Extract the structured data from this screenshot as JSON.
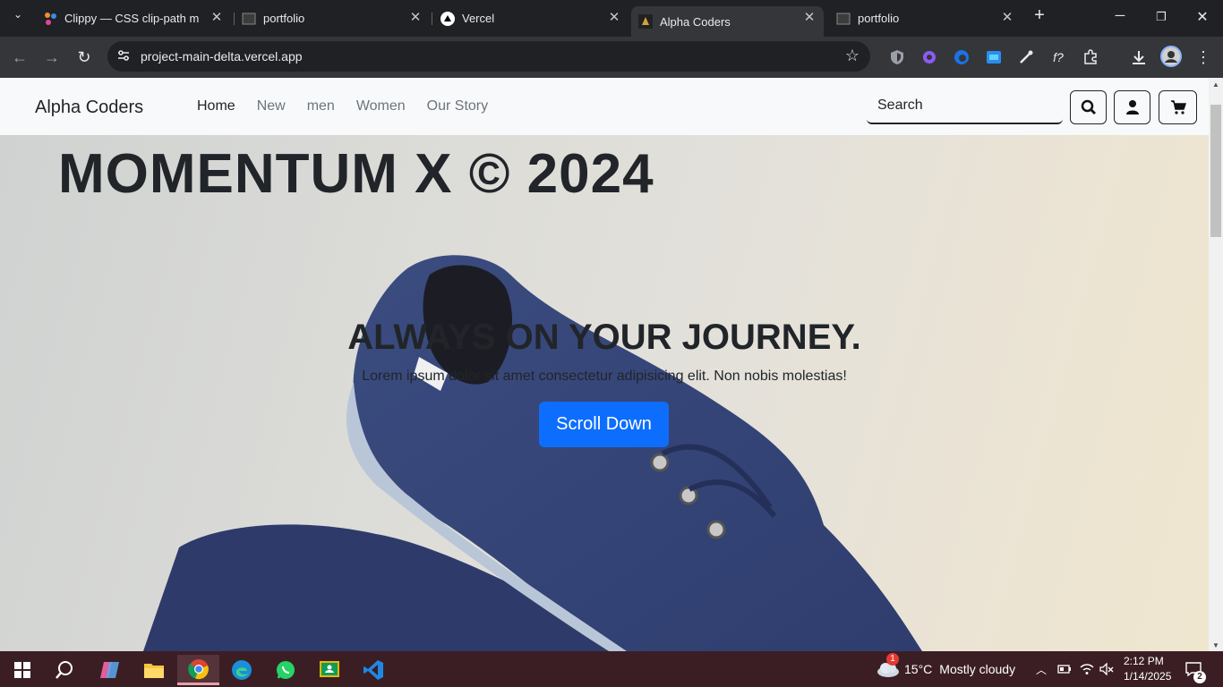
{
  "browser": {
    "tabs": [
      {
        "title": "Clippy — CSS clip-path maker",
        "favicon": "clippy-icon",
        "active": false
      },
      {
        "title": "portfolio",
        "favicon": "portfolio-icon",
        "active": false
      },
      {
        "title": "Vercel",
        "favicon": "vercel-icon",
        "active": false
      },
      {
        "title": "Alpha Coders",
        "favicon": "alpha-coders-icon",
        "active": true
      },
      {
        "title": "portfolio",
        "favicon": "portfolio-icon",
        "active": false
      }
    ],
    "url": "project-main-delta.vercel.app",
    "accent": "#35363a"
  },
  "site": {
    "brand": "Alpha Coders",
    "nav": [
      "Home",
      "New",
      "men",
      "Women",
      "Our Story"
    ],
    "search_placeholder": "Search",
    "hero_title": "MOMENTUM X © 2024",
    "headline": "ALWAYS ON YOUR JOURNEY.",
    "lead": "Lorem ipsum dolor sit amet consectetur adipisicing elit. Non nobis molestias!",
    "cta": "Scroll Down",
    "cta_color": "#0d6efd"
  },
  "taskbar": {
    "weather_temp": "15°C",
    "weather_text": "Mostly cloudy",
    "weather_badge": "1",
    "time": "2:12 PM",
    "date": "1/14/2025",
    "notifications": "2"
  }
}
